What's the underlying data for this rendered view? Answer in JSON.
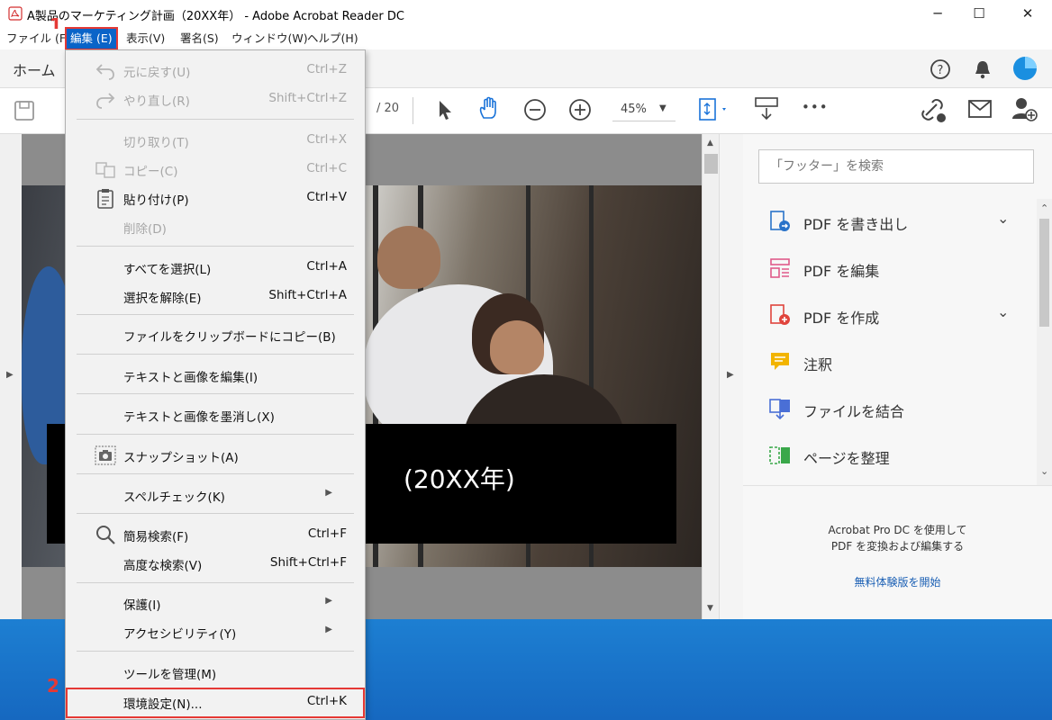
{
  "window": {
    "title": "A製品のマーケティング計画（20XX年） - Adobe Acrobat Reader DC",
    "minimize": "─",
    "maximize": "☐",
    "close": "✕"
  },
  "menubar": {
    "items": [
      "ファイル (F)",
      "編集 (E)",
      "表示(V)",
      "署名(S)",
      "ウィンドウ(W)",
      "ヘルプ(H)"
    ]
  },
  "tabs": {
    "home": "ホーム"
  },
  "toolbar": {
    "page_total": "/ 20",
    "zoom": "45%",
    "more": "•••"
  },
  "document": {
    "banner_text": "(20XX年)"
  },
  "edit_menu": {
    "items": [
      {
        "label": "元に戻す(U)",
        "shortcut": "Ctrl+Z",
        "enabled": false,
        "icon": "undo-icon"
      },
      {
        "label": "やり直し(R)",
        "shortcut": "Shift+Ctrl+Z",
        "enabled": false,
        "icon": "redo-icon"
      },
      {
        "label": "切り取り(T)",
        "shortcut": "Ctrl+X",
        "enabled": false,
        "icon": ""
      },
      {
        "label": "コピー(C)",
        "shortcut": "Ctrl+C",
        "enabled": false,
        "icon": "copy-icon"
      },
      {
        "label": "貼り付け(P)",
        "shortcut": "Ctrl+V",
        "enabled": true,
        "icon": "paste-icon"
      },
      {
        "label": "削除(D)",
        "shortcut": "",
        "enabled": false,
        "icon": ""
      },
      {
        "label": "すべてを選択(L)",
        "shortcut": "Ctrl+A",
        "enabled": true,
        "icon": ""
      },
      {
        "label": "選択を解除(E)",
        "shortcut": "Shift+Ctrl+A",
        "enabled": true,
        "icon": ""
      },
      {
        "label": "ファイルをクリップボードにコピー(B)",
        "shortcut": "",
        "enabled": true,
        "icon": ""
      },
      {
        "label": "テキストと画像を編集(I)",
        "shortcut": "",
        "enabled": true,
        "icon": ""
      },
      {
        "label": "テキストと画像を墨消し(X)",
        "shortcut": "",
        "enabled": true,
        "icon": ""
      },
      {
        "label": "スナップショット(A)",
        "shortcut": "",
        "enabled": true,
        "icon": "camera-icon"
      },
      {
        "label": "スペルチェック(K)",
        "shortcut": "",
        "enabled": true,
        "icon": "",
        "submenu": true
      },
      {
        "label": "簡易検索(F)",
        "shortcut": "Ctrl+F",
        "enabled": true,
        "icon": "search-icon"
      },
      {
        "label": "高度な検索(V)",
        "shortcut": "Shift+Ctrl+F",
        "enabled": true,
        "icon": ""
      },
      {
        "label": "保護(I)",
        "shortcut": "",
        "enabled": true,
        "icon": "",
        "submenu": true
      },
      {
        "label": "アクセシビリティ(Y)",
        "shortcut": "",
        "enabled": true,
        "icon": "",
        "submenu": true
      },
      {
        "label": "ツールを管理(M)",
        "shortcut": "",
        "enabled": true,
        "icon": ""
      },
      {
        "label": "環境設定(N)...",
        "shortcut": "Ctrl+K",
        "enabled": true,
        "icon": ""
      }
    ]
  },
  "right_pane": {
    "search_placeholder": "「フッター」を検索",
    "tools": [
      {
        "label": "PDF を書き出し",
        "icon": "export-pdf-icon",
        "color": "#2a73c9",
        "expandable": true
      },
      {
        "label": "PDF を編集",
        "icon": "edit-pdf-icon",
        "color": "#e05a8a",
        "expandable": false
      },
      {
        "label": "PDF を作成",
        "icon": "create-pdf-icon",
        "color": "#e0443c",
        "expandable": true
      },
      {
        "label": "注釈",
        "icon": "comment-icon",
        "color": "#f2b400",
        "expandable": false
      },
      {
        "label": "ファイルを結合",
        "icon": "combine-files-icon",
        "color": "#4a6fd6",
        "expandable": false
      },
      {
        "label": "ページを整理",
        "icon": "organize-pages-icon",
        "color": "#3aa84a",
        "expandable": false
      }
    ],
    "promo_line1": "Acrobat Pro DC を使用して",
    "promo_line2": "PDF を変換および編集する",
    "promo_link": "無料体験版を開始"
  },
  "annotations": {
    "step1": "1",
    "step2": "2"
  },
  "colors": {
    "accent": "#0a64c8",
    "highlight": "#e53935",
    "desktop": "#1668c0"
  }
}
